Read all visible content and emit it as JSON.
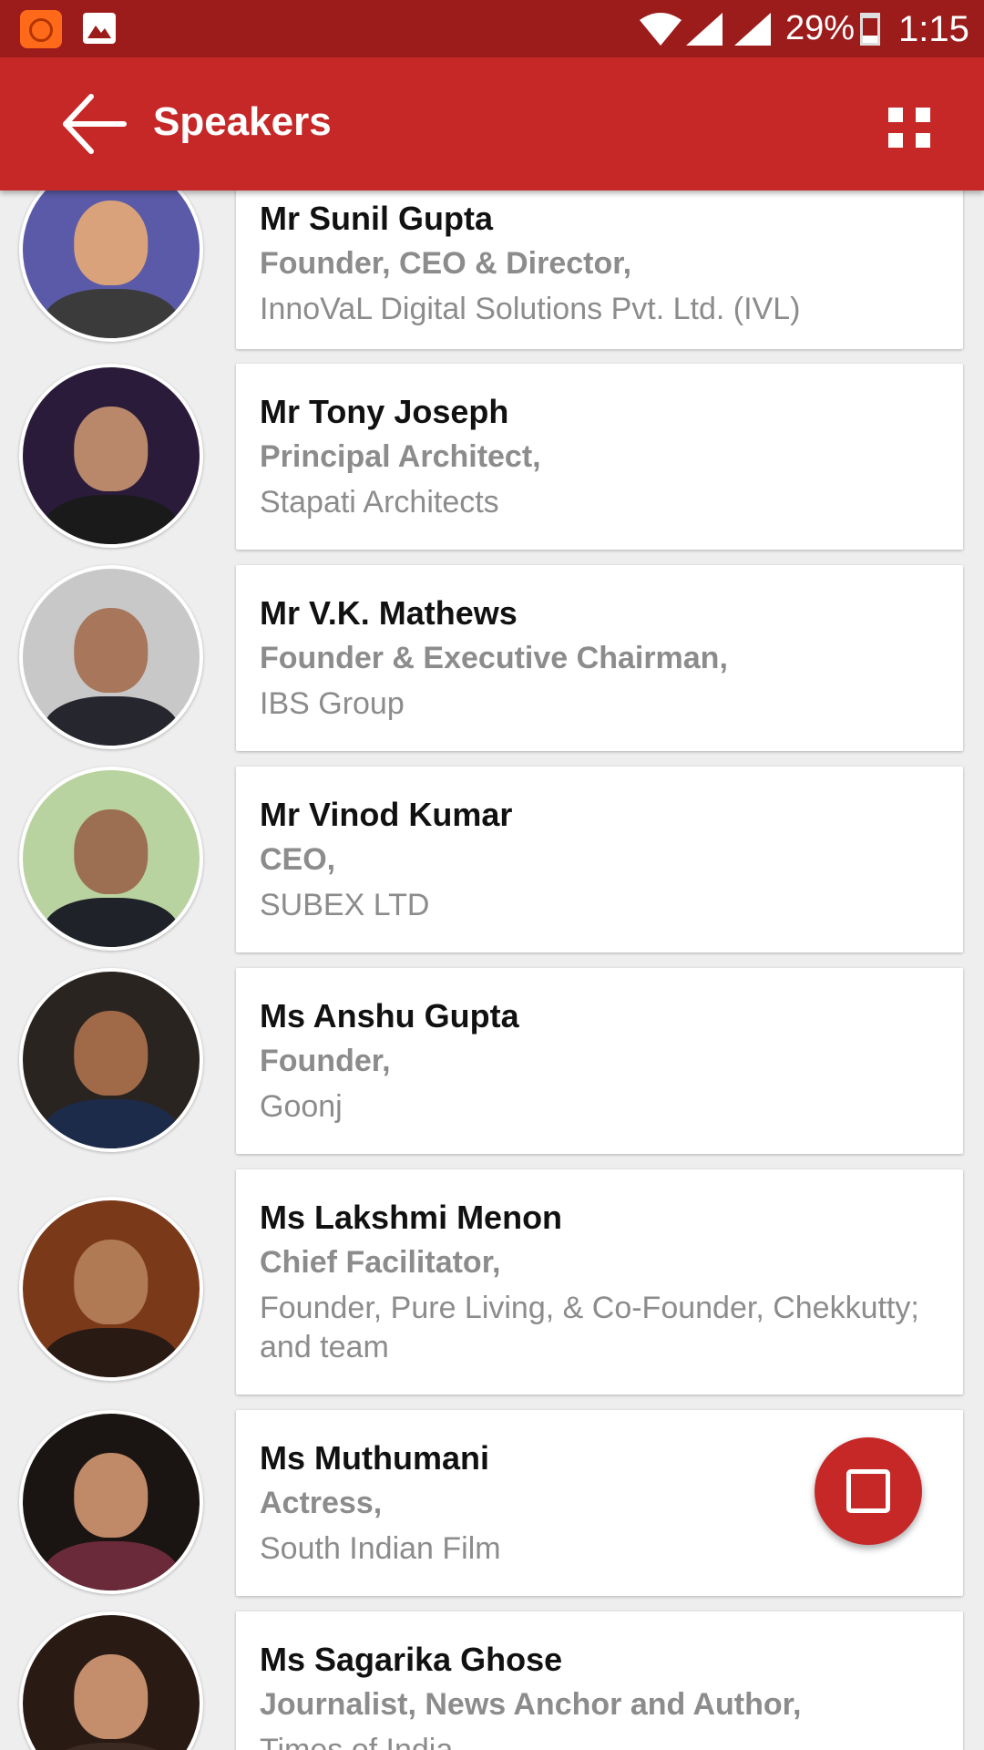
{
  "status_bar": {
    "battery": "29%",
    "time": "1:15"
  },
  "app_bar": {
    "title": "Speakers"
  },
  "speakers": [
    {
      "name": "Mr Sunil Gupta",
      "role": "Founder, CEO & Director,",
      "org": "InnoVaL Digital Solutions Pvt. Ltd. (IVL)"
    },
    {
      "name": "Mr Tony Joseph",
      "role": "Principal Architect,",
      "org": "Stapati Architects"
    },
    {
      "name": "Mr V.K. Mathews",
      "role": "Founder & Executive Chairman,",
      "org": "IBS Group"
    },
    {
      "name": "Mr Vinod Kumar",
      "role": "CEO,",
      "org": "SUBEX LTD"
    },
    {
      "name": "Ms Anshu Gupta",
      "role": "Founder,",
      "org": "Goonj"
    },
    {
      "name": "Ms Lakshmi Menon",
      "role": "Chief Facilitator,",
      "org": "Founder, Pure Living, & Co-Founder, Chekkutty; and team"
    },
    {
      "name": "Ms Muthumani",
      "role": "Actress,",
      "org": "South Indian Film"
    },
    {
      "name": "Ms Sagarika Ghose",
      "role": "Journalist, News Anchor and Author,",
      "org": "Times of India"
    }
  ],
  "colors": {
    "primary": "#c62828",
    "status_bar": "#9c1c1c",
    "background": "#eeeeee",
    "secondary_text": "#8c8c8c"
  },
  "icons": {
    "back": "arrow-left-icon",
    "grid": "grid-view-icon",
    "fab": "square-icon"
  }
}
